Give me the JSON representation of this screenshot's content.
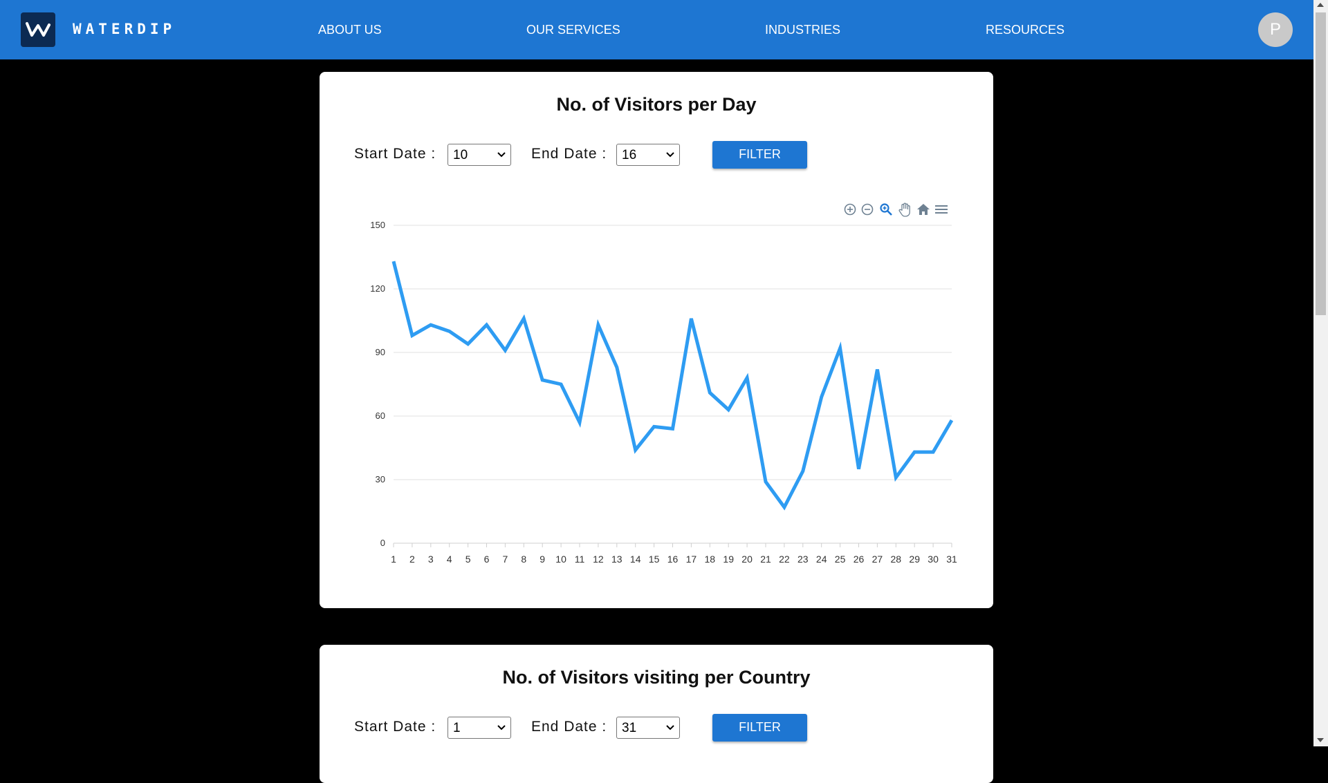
{
  "header": {
    "brand": "WATERDIP",
    "nav": [
      "ABOUT US",
      "OUR SERVICES",
      "INDUSTRIES",
      "RESOURCES"
    ],
    "avatar_initial": "P"
  },
  "visitors_per_day": {
    "title": "No. of Visitors per Day",
    "start_label": "Start Date :",
    "start_value": "10",
    "end_label": "End Date :",
    "end_value": "16",
    "filter_label": "FILTER",
    "toolbar_icons": [
      "zoom-in-icon",
      "zoom-out-icon",
      "selection-zoom-icon",
      "pan-icon",
      "home-icon",
      "menu-icon"
    ]
  },
  "visitors_per_country": {
    "title": "No. of Visitors visiting per Country",
    "start_label": "Start Date :",
    "start_value": "1",
    "end_label": "End Date :",
    "end_value": "31",
    "filter_label": "FILTER"
  },
  "chart_data": {
    "type": "line",
    "x": [
      1,
      2,
      3,
      4,
      5,
      6,
      7,
      8,
      9,
      10,
      11,
      12,
      13,
      14,
      15,
      16,
      17,
      18,
      19,
      20,
      21,
      22,
      23,
      24,
      25,
      26,
      27,
      28,
      29,
      30,
      31
    ],
    "series": [
      {
        "values": [
          133,
          98,
          103,
          100,
          94,
          103,
          91,
          106,
          77,
          75,
          57,
          103,
          83,
          44,
          55,
          54,
          106,
          71,
          63,
          78,
          29,
          17,
          34,
          69,
          92,
          35,
          82,
          31,
          43,
          43,
          58
        ]
      }
    ],
    "yticks": [
      0,
      30,
      60,
      90,
      120,
      150
    ],
    "ylim": [
      0,
      150
    ],
    "grid": true,
    "line_color": "#2e9cf2"
  }
}
